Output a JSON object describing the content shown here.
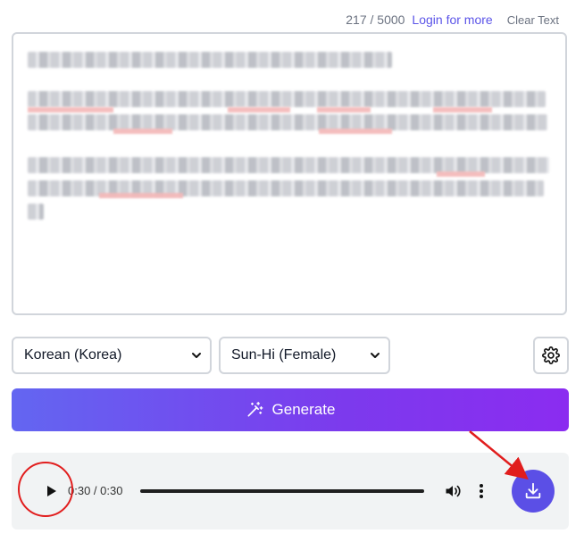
{
  "topbar": {
    "char_count": "217 / 5000",
    "login_link": "Login for more",
    "clear_text": "Clear Text"
  },
  "textarea": {
    "content_state": "blurred"
  },
  "controls": {
    "language_select": "Korean (Korea)",
    "voice_select": "Sun-Hi (Female)",
    "settings_icon": "gear-icon"
  },
  "generate": {
    "label": "Generate",
    "icon": "magic-wand-icon",
    "gradient_start": "#6366f1",
    "gradient_end": "#8b2cf0"
  },
  "player": {
    "time": "0:30 / 0:30",
    "progress": 1.0,
    "play_icon": "play-icon",
    "volume_icon": "volume-icon",
    "more_icon": "more-vertical-icon",
    "download_icon": "download-icon",
    "download_color": "#5b4fe6"
  },
  "annotations": {
    "color": "#e11d1d",
    "marks": [
      "circle-around-play-button",
      "arrow-to-download-button"
    ]
  }
}
